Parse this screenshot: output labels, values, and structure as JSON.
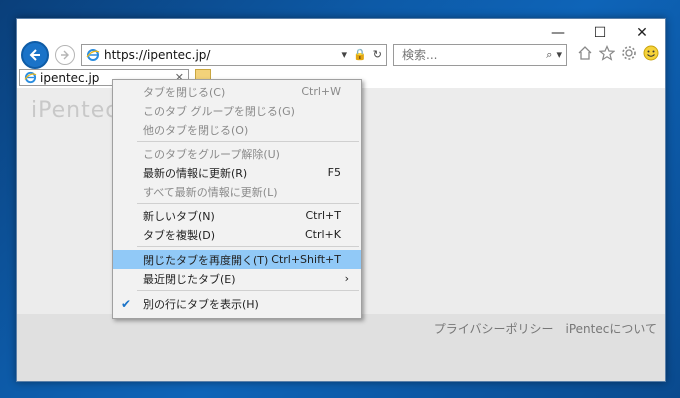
{
  "window": {
    "controls": {
      "minimize": "—",
      "maximize": "☐",
      "close": "✕"
    }
  },
  "address_bar": {
    "url": "https://ipentec.jp/",
    "tools": [
      "▾",
      "🔒",
      "↻"
    ]
  },
  "search": {
    "placeholder": "検索...",
    "icons": [
      "⌕",
      "▾"
    ]
  },
  "toolbar_icons": [
    "home-icon",
    "star-icon",
    "gear-icon",
    "smiley-icon"
  ],
  "tab": {
    "label": "ipentec.jp",
    "close": "✕"
  },
  "page": {
    "logo": "iPentec",
    "footer_links": [
      "プライバシーポリシー",
      "iPentecについて"
    ]
  },
  "context_menu": {
    "items": [
      {
        "label": "タブを閉じる(C)",
        "shortcut": "Ctrl+W",
        "disabled": true
      },
      {
        "label": "このタブ グループを閉じる(G)",
        "shortcut": "",
        "disabled": true
      },
      {
        "label": "他のタブを閉じる(O)",
        "shortcut": "",
        "disabled": true
      },
      {
        "label": "このタブをグループ解除(U)",
        "shortcut": "",
        "disabled": true
      },
      {
        "label": "最新の情報に更新(R)",
        "shortcut": "F5",
        "disabled": false
      },
      {
        "label": "すべて最新の情報に更新(L)",
        "shortcut": "",
        "disabled": true
      },
      {
        "label": "新しいタブ(N)",
        "shortcut": "Ctrl+T",
        "disabled": false
      },
      {
        "label": "タブを複製(D)",
        "shortcut": "Ctrl+K",
        "disabled": false
      },
      {
        "label": "閉じたタブを再度開く(T)",
        "shortcut": "Ctrl+Shift+T",
        "disabled": false,
        "highlighted": true
      },
      {
        "label": "最近閉じたタブ(E)",
        "shortcut": "",
        "disabled": false,
        "submenu": true
      },
      {
        "label": "別の行にタブを表示(H)",
        "shortcut": "",
        "disabled": false,
        "checked": true
      }
    ]
  },
  "colors": {
    "accent": "#1a73c8",
    "highlight": "#91c9f7",
    "desktop": "#0d5aa7"
  }
}
